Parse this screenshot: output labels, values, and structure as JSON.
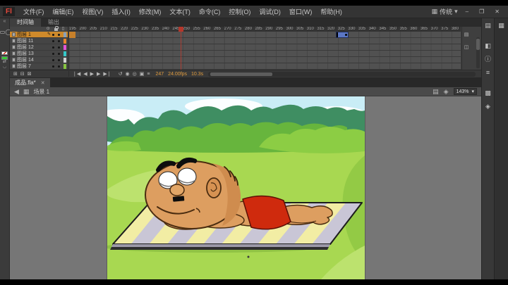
{
  "menu_bar": {
    "logo": "Fl",
    "items": [
      "文件(F)",
      "编辑(E)",
      "视图(V)",
      "插入(I)",
      "修改(M)",
      "文本(T)",
      "命令(C)",
      "控制(O)",
      "调试(D)",
      "窗口(W)",
      "帮助(H)"
    ],
    "workspace": {
      "icon": "▦",
      "label": "传统",
      "dropdown": "▾"
    },
    "window_controls": [
      "–",
      "❐",
      "✕"
    ]
  },
  "tools_panel": {
    "collapse_icon": "«",
    "tools": [
      {
        "name": "selection-tool",
        "glyph": "➤",
        "selected": true
      },
      {
        "name": "subselection-tool",
        "glyph": "▷"
      },
      {
        "name": "free-transform-tool",
        "glyph": "▣"
      },
      {
        "name": "3d-rotation-tool",
        "glyph": "◈"
      },
      {
        "name": "lasso-tool",
        "glyph": "✇"
      },
      {
        "name": "pen-tool",
        "glyph": "✒"
      },
      {
        "name": "text-tool",
        "glyph": "T"
      },
      {
        "name": "line-tool",
        "glyph": "╲"
      },
      {
        "name": "rectangle-tool",
        "glyph": "▭"
      },
      {
        "name": "oval-tool",
        "glyph": "◯"
      },
      {
        "name": "pencil-tool",
        "glyph": "✎"
      },
      {
        "name": "brush-tool",
        "glyph": "✐"
      },
      {
        "name": "deco-tool",
        "glyph": "❆"
      },
      {
        "name": "bone-tool",
        "glyph": "∿"
      },
      {
        "name": "paint-bucket-tool",
        "glyph": "◍"
      },
      {
        "name": "eyedropper-tool",
        "glyph": "✑"
      },
      {
        "name": "eraser-tool",
        "glyph": "▱"
      },
      {
        "name": "hand-tool",
        "glyph": "☛"
      },
      {
        "name": "zoom-tool",
        "glyph": "⊙"
      }
    ],
    "fill_color": "#35cc35",
    "snap_icon": "◡"
  },
  "timeline": {
    "tabs": [
      {
        "label": "时间轴",
        "active": true
      },
      {
        "label": "输出",
        "active": false
      }
    ],
    "layers": [
      {
        "name": "图层 1",
        "selected": true,
        "editing": true,
        "outline_color": "#8aa0b8"
      },
      {
        "name": "图层 11",
        "outline_color": "#e8862c"
      },
      {
        "name": "图层 12",
        "outline_color": "#e353d6"
      },
      {
        "name": "图层 13",
        "outline_color": "#35c8c8"
      },
      {
        "name": "图层 14",
        "outline_color": "#d2d2d2"
      },
      {
        "name": "图层 7",
        "outline_color": "#86c440"
      }
    ],
    "ruler_labels": [
      195,
      200,
      205,
      210,
      215,
      220,
      225,
      230,
      235,
      240,
      245,
      250,
      255,
      260,
      265,
      270,
      275,
      280,
      285,
      290,
      295,
      300,
      305,
      310,
      315,
      320,
      325,
      330,
      335,
      340,
      345,
      350,
      355,
      360,
      365,
      370,
      375,
      380
    ],
    "playhead_frame": 247,
    "tween_span": {
      "start": 322,
      "end": 328
    },
    "layer_ops": [
      {
        "name": "new-layer-button",
        "glyph": "⊞"
      },
      {
        "name": "new-folder-button",
        "glyph": "⊟"
      },
      {
        "name": "delete-layer-button",
        "glyph": "⊠"
      }
    ],
    "frame_controls": [
      {
        "name": "go-to-first-frame-button",
        "glyph": "❘◀"
      },
      {
        "name": "step-back-one-frame-button",
        "glyph": "◀"
      },
      {
        "name": "play-button",
        "glyph": "▶"
      },
      {
        "name": "step-forward-one-frame-button",
        "glyph": "▶"
      },
      {
        "name": "go-to-last-frame-button",
        "glyph": "▶❘"
      }
    ],
    "onion_controls": [
      {
        "name": "loop-button",
        "glyph": "↺"
      },
      {
        "name": "onion-skin-button",
        "glyph": "◉"
      },
      {
        "name": "onion-skin-outlines-button",
        "glyph": "◎"
      },
      {
        "name": "edit-multiple-frames-button",
        "glyph": "▣"
      },
      {
        "name": "modify-markers-button",
        "glyph": "≡"
      }
    ],
    "status": {
      "current_frame": "247",
      "frame_rate": "24.00fps",
      "elapsed_time": "10.3s"
    },
    "corner_buttons": [
      {
        "name": "center-frame-button",
        "glyph": "▤"
      },
      {
        "name": "onion-markers-button",
        "glyph": "◫"
      }
    ]
  },
  "document_bar": {
    "tab_title": "成品.fla*",
    "close_glyph": "✕"
  },
  "edit_bar": {
    "back_icon": "◀",
    "scene_icon": "▦",
    "scene_label": "场景 1",
    "edit_scene_icon": "▤",
    "edit_symbol_icon": "◈",
    "zoom_value": "143%",
    "dropdown_icon": "▾"
  },
  "right_dock": {
    "inner_icons": [
      {
        "name": "properties-panel-icon",
        "glyph": "▤"
      },
      {
        "name": "color-panel-icon",
        "glyph": "◧",
        "gap": true
      },
      {
        "name": "info-panel-icon",
        "glyph": "ⓘ"
      },
      {
        "name": "align-panel-icon",
        "glyph": "≡"
      },
      {
        "name": "swatches-panel-icon",
        "glyph": "▩",
        "gap": true
      },
      {
        "name": "transform-panel-icon",
        "glyph": "◈"
      }
    ],
    "outer_icons": [
      {
        "name": "library-panel-icon",
        "glyph": "▦"
      }
    ]
  },
  "stage": {
    "colors": {
      "sky": "#c9edf6",
      "cloud": "#ffffff",
      "bush_dark": "#3f8e62",
      "bush_mid": "#67b53d",
      "bush_light": "#8ccd44",
      "grass": "#a8d851",
      "grass_light": "#bce26e",
      "grass_dark": "#93ca45",
      "mat_yellow": "#f2eda4",
      "mat_gray": "#c9c6d6",
      "skin": "#dd9e60",
      "skin_shade": "#cf8c4e",
      "outline": "#4a2c10",
      "trunks": "#cf2a0d",
      "eye_white": "#ffffff",
      "brow": "#0d0d0d"
    }
  }
}
